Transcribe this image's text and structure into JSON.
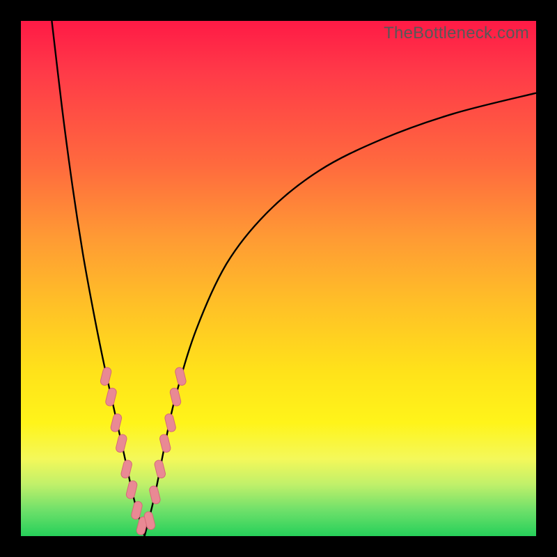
{
  "watermark": "TheBottleneck.com",
  "colors": {
    "frame": "#000000",
    "gradient_stops": [
      "#ff1a46",
      "#ff3a48",
      "#ff6a3e",
      "#ff9a34",
      "#ffc027",
      "#ffe21a",
      "#fff41a",
      "#f4f85a",
      "#c0f06a",
      "#6ee06a",
      "#26d05a"
    ],
    "curve": "#000000",
    "marker_fill": "#e98994",
    "marker_stroke": "#d46b77"
  },
  "chart_data": {
    "type": "line",
    "title": "",
    "xlabel": "",
    "ylabel": "",
    "xlim": [
      0,
      100
    ],
    "ylim": [
      0,
      100
    ],
    "note": "Axes are unlabeled in the source image; values are estimated on a 0–100 normalized scale. y≈0 is best (green), y≈100 is worst (red). Two curve branches meet near x≈24,y≈0.",
    "series": [
      {
        "name": "left-branch",
        "x": [
          6,
          8,
          10,
          12,
          14,
          16,
          18,
          20,
          22,
          24
        ],
        "y": [
          100,
          83,
          68,
          55,
          44,
          34,
          25,
          16,
          7,
          0
        ]
      },
      {
        "name": "right-branch",
        "x": [
          24,
          26,
          28,
          30,
          34,
          40,
          48,
          58,
          70,
          84,
          100
        ],
        "y": [
          0,
          8,
          18,
          27,
          40,
          53,
          63,
          71,
          77,
          82,
          86
        ]
      }
    ],
    "markers_note": "Pink lozenge markers cluster along both branches near the valley, roughly y ∈ [2, 32].",
    "markers_left": [
      {
        "x": 16.5,
        "y": 31
      },
      {
        "x": 17.5,
        "y": 27
      },
      {
        "x": 18.5,
        "y": 22
      },
      {
        "x": 19.5,
        "y": 18
      },
      {
        "x": 20.5,
        "y": 13
      },
      {
        "x": 21.5,
        "y": 9
      },
      {
        "x": 22.5,
        "y": 5
      },
      {
        "x": 23.5,
        "y": 2
      }
    ],
    "markers_right": [
      {
        "x": 25.0,
        "y": 3
      },
      {
        "x": 26.0,
        "y": 8
      },
      {
        "x": 27.0,
        "y": 13
      },
      {
        "x": 28.0,
        "y": 18
      },
      {
        "x": 29.0,
        "y": 22
      },
      {
        "x": 30.0,
        "y": 27
      },
      {
        "x": 31.0,
        "y": 31
      }
    ]
  }
}
